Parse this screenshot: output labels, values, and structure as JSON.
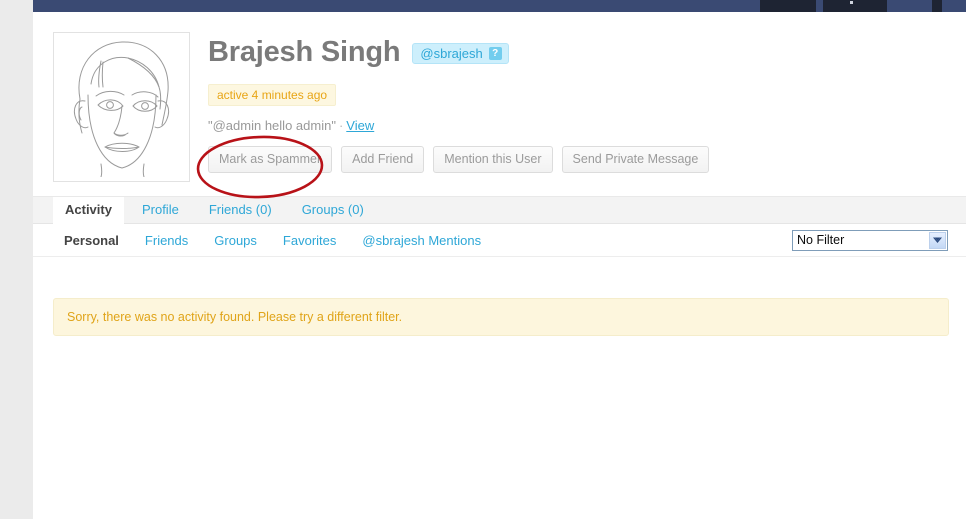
{
  "adminbar": {
    "label": "wordpress-admin-bar"
  },
  "profile": {
    "fullname": "Brajesh Singh",
    "nicename": "@sbrajesh",
    "help_badge": "?",
    "activity_status": "active 4 minutes ago",
    "latest_update_text": "\"@admin hello admin\"",
    "latest_update_separator": "·",
    "latest_update_link": "View",
    "avatar_alt": "Brajesh Singh avatar"
  },
  "actions": [
    {
      "label": "Mark as Spammer",
      "name": "mark-as-spammer-button"
    },
    {
      "label": "Add Friend",
      "name": "add-friend-button"
    },
    {
      "label": "Mention this User",
      "name": "mention-this-user-button"
    },
    {
      "label": "Send Private Message",
      "name": "send-private-message-button"
    }
  ],
  "nav_tabs": [
    {
      "label": "Activity",
      "current": true
    },
    {
      "label": "Profile",
      "current": false
    },
    {
      "label": "Friends (0)",
      "current": false
    },
    {
      "label": "Groups (0)",
      "current": false
    }
  ],
  "subnav_tabs": [
    {
      "label": "Personal",
      "current": true
    },
    {
      "label": "Friends",
      "current": false
    },
    {
      "label": "Groups",
      "current": false
    },
    {
      "label": "Favorites",
      "current": false
    },
    {
      "label": "@sbrajesh Mentions",
      "current": false
    }
  ],
  "filter": {
    "selected": "No Filter",
    "options": [
      "No Filter"
    ]
  },
  "notice": {
    "message": "Sorry, there was no activity found. Please try a different filter."
  },
  "annotation": {
    "shape": "ellipse",
    "color": "#b81218",
    "target": "Mark as Spammer"
  },
  "colors": {
    "link": "#2ea7d7",
    "nicename_bg": "#cdeffc",
    "notice_bg": "#fdf6dd",
    "notice_text": "#e0a419",
    "adminbar": "#3a4a73",
    "annotation": "#b81218"
  }
}
